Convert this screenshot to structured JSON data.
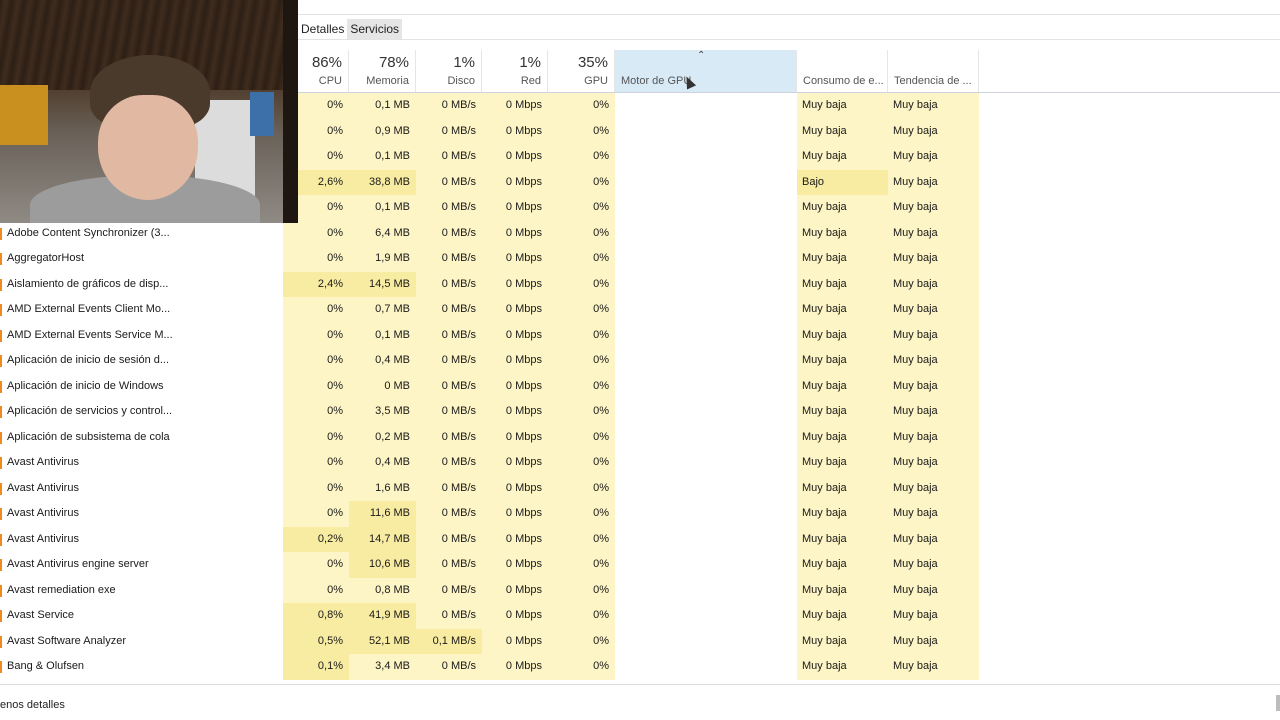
{
  "tabs": [
    {
      "label": "Detalles",
      "active": false
    },
    {
      "label": "Servicios",
      "active": true
    }
  ],
  "header": {
    "cpu": {
      "pct": "86%",
      "label": "CPU"
    },
    "memory": {
      "pct": "78%",
      "label": "Memoria"
    },
    "disk": {
      "pct": "1%",
      "label": "Disco"
    },
    "network": {
      "pct": "1%",
      "label": "Red"
    },
    "gpu": {
      "pct": "35%",
      "label": "GPU"
    },
    "gpu_engine": {
      "label": "Motor de GPU",
      "sort_arrow": "⌃"
    },
    "power": {
      "label": "Consumo de e..."
    },
    "power_trend": {
      "label": "Tendencia de ..."
    }
  },
  "processes": [
    {
      "name": "",
      "cpu": "0%",
      "mem": "0,1 MB",
      "disk": "0 MB/s",
      "net": "0 Mbps",
      "gpu": "0%",
      "engine": "",
      "power": "Muy baja",
      "trend": "Muy baja"
    },
    {
      "name": "",
      "cpu": "0%",
      "mem": "0,9 MB",
      "disk": "0 MB/s",
      "net": "0 Mbps",
      "gpu": "0%",
      "engine": "",
      "power": "Muy baja",
      "trend": "Muy baja"
    },
    {
      "name": "",
      "cpu": "0%",
      "mem": "0,1 MB",
      "disk": "0 MB/s",
      "net": "0 Mbps",
      "gpu": "0%",
      "engine": "",
      "power": "Muy baja",
      "trend": "Muy baja"
    },
    {
      "name": "",
      "cpu": "2,6%",
      "mem": "38,8 MB",
      "disk": "0 MB/s",
      "net": "0 Mbps",
      "gpu": "0%",
      "engine": "",
      "power": "Bajo",
      "trend": "Muy baja"
    },
    {
      "name": "",
      "cpu": "0%",
      "mem": "0,1 MB",
      "disk": "0 MB/s",
      "net": "0 Mbps",
      "gpu": "0%",
      "engine": "",
      "power": "Muy baja",
      "trend": "Muy baja"
    },
    {
      "name": "Adobe Content Synchronizer (3...",
      "cpu": "0%",
      "mem": "6,4 MB",
      "disk": "0 MB/s",
      "net": "0 Mbps",
      "gpu": "0%",
      "engine": "",
      "power": "Muy baja",
      "trend": "Muy baja"
    },
    {
      "name": "AggregatorHost",
      "cpu": "0%",
      "mem": "1,9 MB",
      "disk": "0 MB/s",
      "net": "0 Mbps",
      "gpu": "0%",
      "engine": "",
      "power": "Muy baja",
      "trend": "Muy baja"
    },
    {
      "name": "Aislamiento de gráficos de disp...",
      "cpu": "2,4%",
      "mem": "14,5 MB",
      "disk": "0 MB/s",
      "net": "0 Mbps",
      "gpu": "0%",
      "engine": "",
      "power": "Muy baja",
      "trend": "Muy baja"
    },
    {
      "name": "AMD External Events Client Mo...",
      "cpu": "0%",
      "mem": "0,7 MB",
      "disk": "0 MB/s",
      "net": "0 Mbps",
      "gpu": "0%",
      "engine": "",
      "power": "Muy baja",
      "trend": "Muy baja"
    },
    {
      "name": "AMD External Events Service M...",
      "cpu": "0%",
      "mem": "0,1 MB",
      "disk": "0 MB/s",
      "net": "0 Mbps",
      "gpu": "0%",
      "engine": "",
      "power": "Muy baja",
      "trend": "Muy baja"
    },
    {
      "name": "Aplicación de inicio de sesión d...",
      "cpu": "0%",
      "mem": "0,4 MB",
      "disk": "0 MB/s",
      "net": "0 Mbps",
      "gpu": "0%",
      "engine": "",
      "power": "Muy baja",
      "trend": "Muy baja"
    },
    {
      "name": "Aplicación de inicio de Windows",
      "cpu": "0%",
      "mem": "0 MB",
      "disk": "0 MB/s",
      "net": "0 Mbps",
      "gpu": "0%",
      "engine": "",
      "power": "Muy baja",
      "trend": "Muy baja"
    },
    {
      "name": "Aplicación de servicios y control...",
      "cpu": "0%",
      "mem": "3,5 MB",
      "disk": "0 MB/s",
      "net": "0 Mbps",
      "gpu": "0%",
      "engine": "",
      "power": "Muy baja",
      "trend": "Muy baja"
    },
    {
      "name": "Aplicación de subsistema de cola",
      "cpu": "0%",
      "mem": "0,2 MB",
      "disk": "0 MB/s",
      "net": "0 Mbps",
      "gpu": "0%",
      "engine": "",
      "power": "Muy baja",
      "trend": "Muy baja"
    },
    {
      "name": "Avast Antivirus",
      "cpu": "0%",
      "mem": "0,4 MB",
      "disk": "0 MB/s",
      "net": "0 Mbps",
      "gpu": "0%",
      "engine": "",
      "power": "Muy baja",
      "trend": "Muy baja"
    },
    {
      "name": "Avast Antivirus",
      "cpu": "0%",
      "mem": "1,6 MB",
      "disk": "0 MB/s",
      "net": "0 Mbps",
      "gpu": "0%",
      "engine": "",
      "power": "Muy baja",
      "trend": "Muy baja"
    },
    {
      "name": "Avast Antivirus",
      "cpu": "0%",
      "mem": "11,6 MB",
      "disk": "0 MB/s",
      "net": "0 Mbps",
      "gpu": "0%",
      "engine": "",
      "power": "Muy baja",
      "trend": "Muy baja"
    },
    {
      "name": "Avast Antivirus",
      "cpu": "0,2%",
      "mem": "14,7 MB",
      "disk": "0 MB/s",
      "net": "0 Mbps",
      "gpu": "0%",
      "engine": "",
      "power": "Muy baja",
      "trend": "Muy baja"
    },
    {
      "name": "Avast Antivirus engine server",
      "cpu": "0%",
      "mem": "10,6 MB",
      "disk": "0 MB/s",
      "net": "0 Mbps",
      "gpu": "0%",
      "engine": "",
      "power": "Muy baja",
      "trend": "Muy baja"
    },
    {
      "name": "Avast remediation exe",
      "cpu": "0%",
      "mem": "0,8 MB",
      "disk": "0 MB/s",
      "net": "0 Mbps",
      "gpu": "0%",
      "engine": "",
      "power": "Muy baja",
      "trend": "Muy baja"
    },
    {
      "name": "Avast Service",
      "cpu": "0,8%",
      "mem": "41,9 MB",
      "disk": "0 MB/s",
      "net": "0 Mbps",
      "gpu": "0%",
      "engine": "",
      "power": "Muy baja",
      "trend": "Muy baja"
    },
    {
      "name": "Avast Software Analyzer",
      "cpu": "0,5%",
      "mem": "52,1 MB",
      "disk": "0,1 MB/s",
      "net": "0 Mbps",
      "gpu": "0%",
      "engine": "",
      "power": "Muy baja",
      "trend": "Muy baja"
    },
    {
      "name": "Bang & Olufsen",
      "cpu": "0,1%",
      "mem": "3,4 MB",
      "disk": "0 MB/s",
      "net": "0 Mbps",
      "gpu": "0%",
      "engine": "",
      "power": "Muy baja",
      "trend": "Muy baja"
    }
  ],
  "footer": {
    "less_details_label": "enos detalles"
  },
  "colors": {
    "usage_low": "#fdf5c5",
    "usage_mid": "#f8eca2",
    "sorted_header": "#d9eaf7",
    "icon_mark": "#f08a1c"
  }
}
